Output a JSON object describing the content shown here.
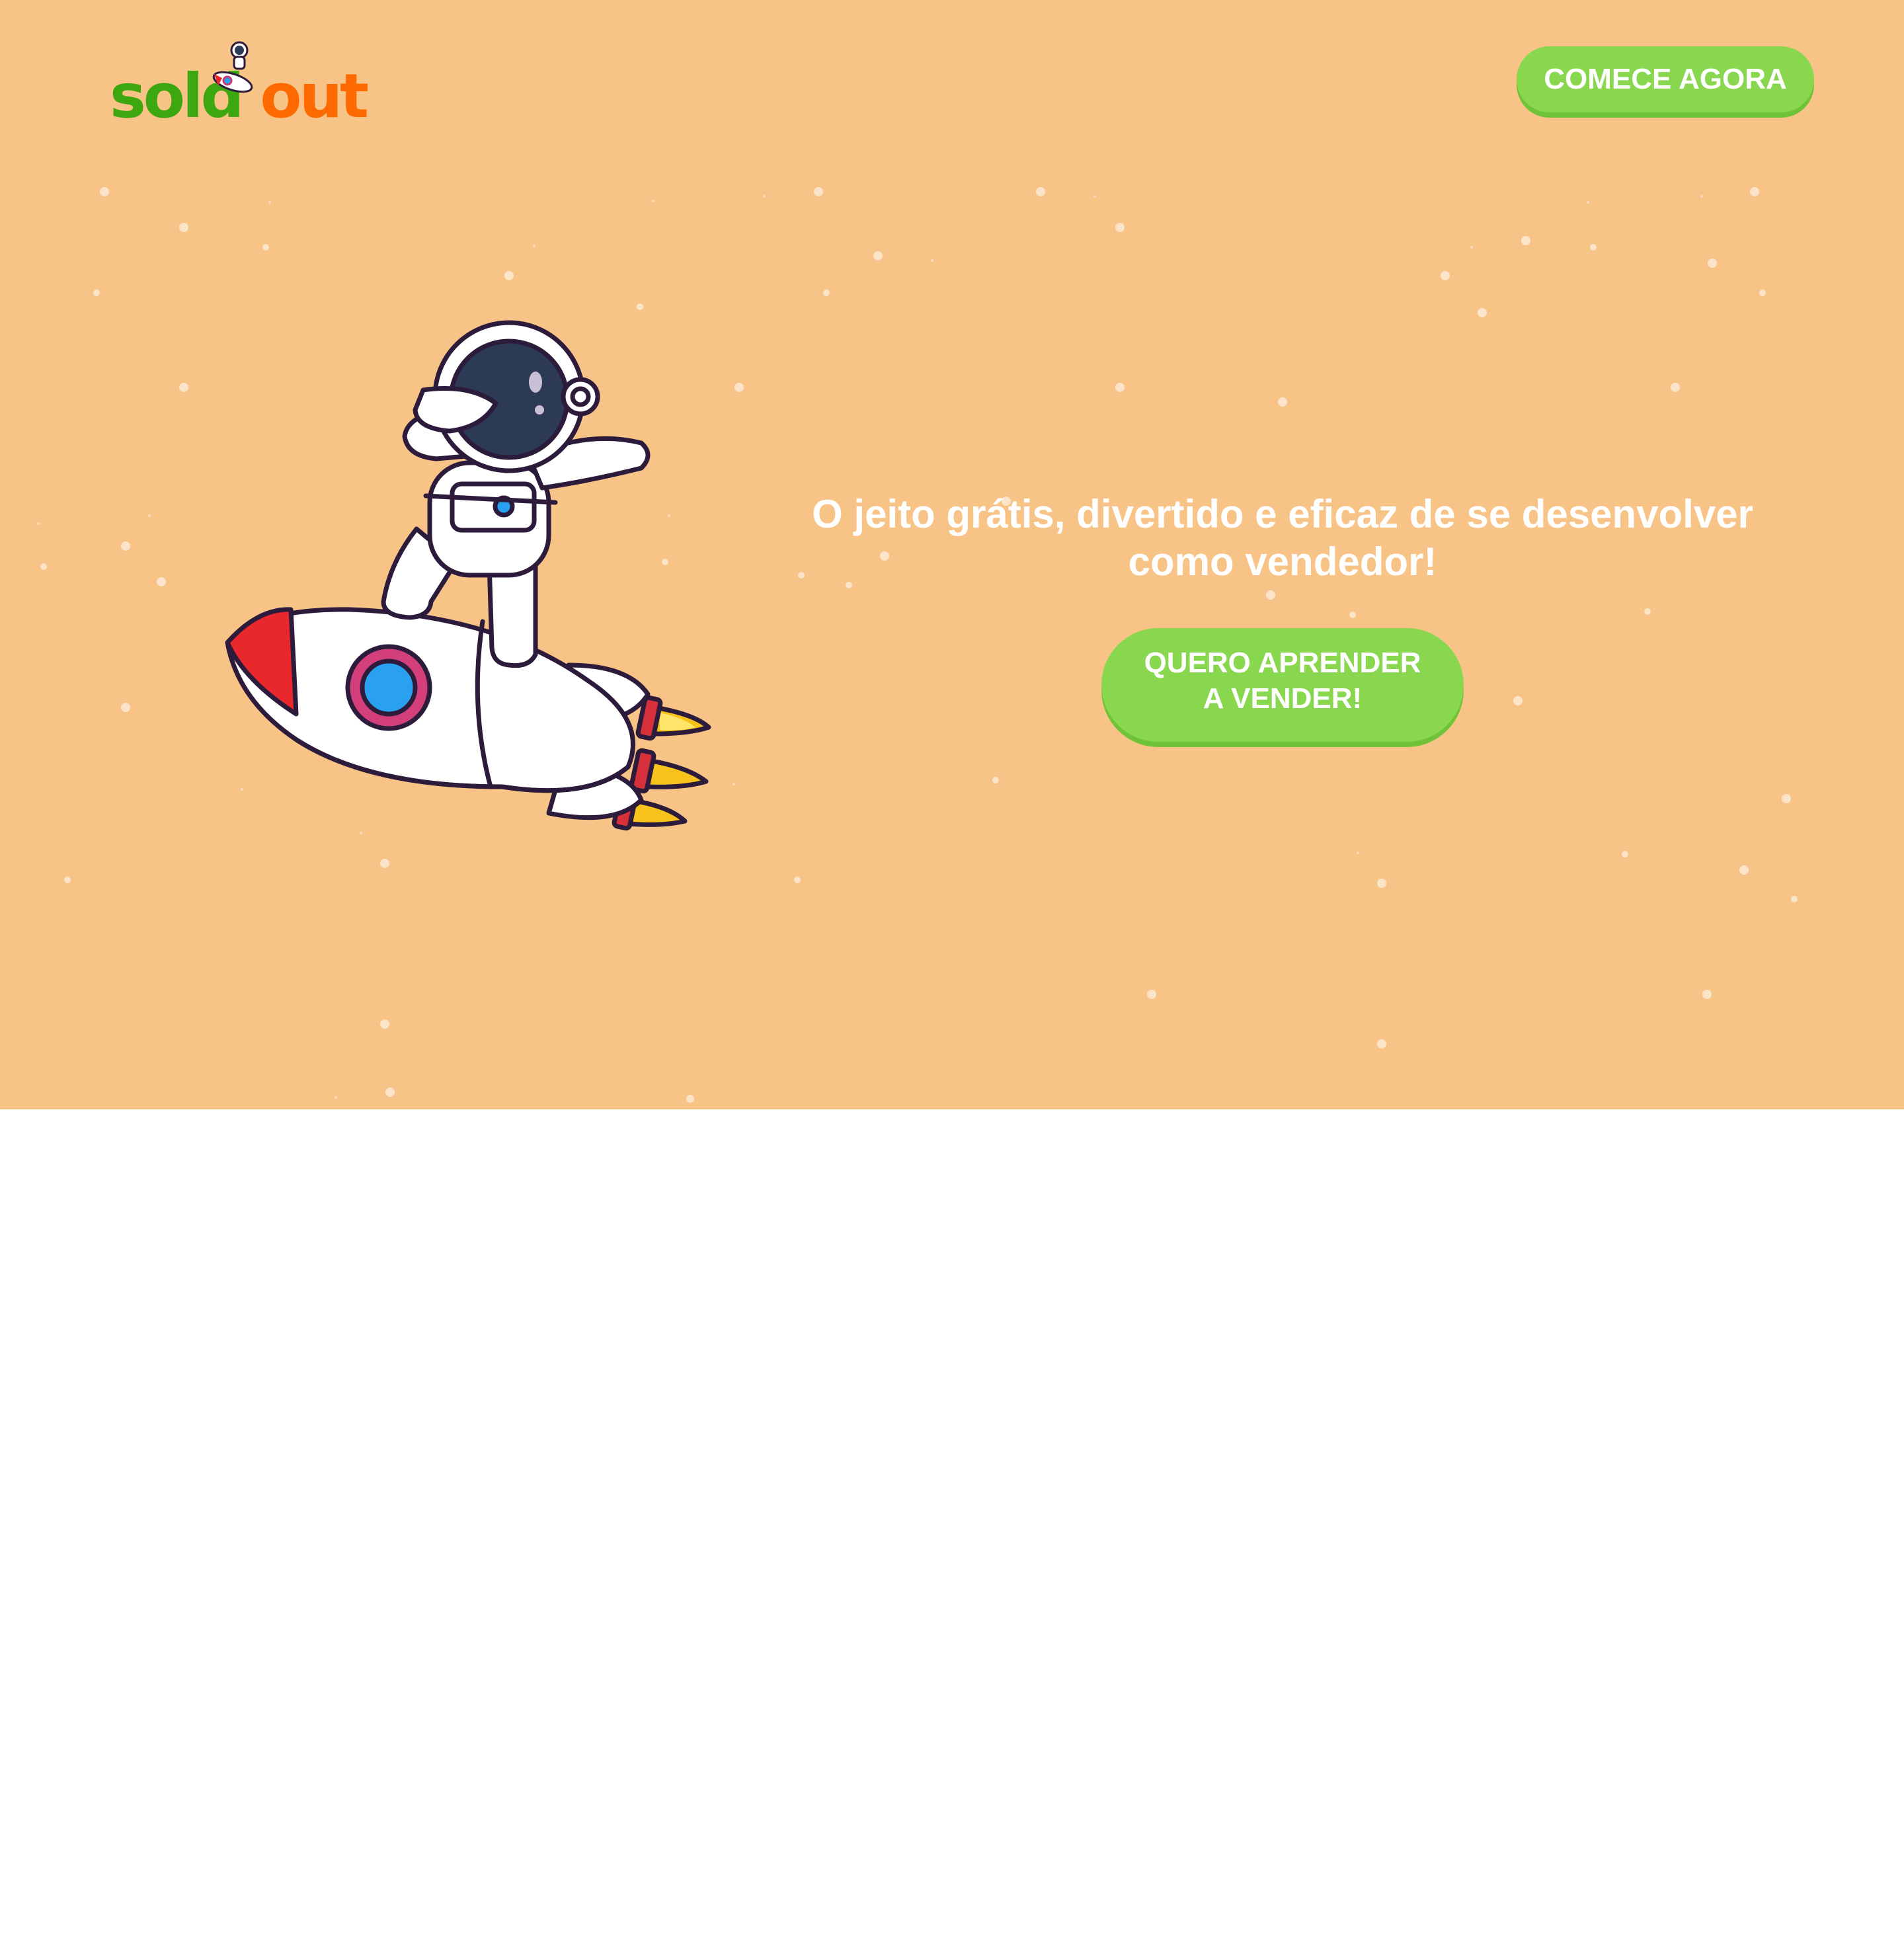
{
  "header": {
    "logo_word_1": "sold",
    "logo_word_2": "out",
    "cta_label": "COMECE AGORA"
  },
  "hero": {
    "headline": "O jeito grátis, divertido e eficaz de se desenvolver como vendedor!",
    "cta_label": "QUERO APRENDER\nA VENDER!",
    "illustration": "astronaut-on-rocket"
  },
  "colors": {
    "hero_background": "#f8c387",
    "button_green": "#88d74f",
    "logo_green": "#3da70f",
    "logo_orange": "#ff6a00",
    "page_background": "#ffffff"
  }
}
